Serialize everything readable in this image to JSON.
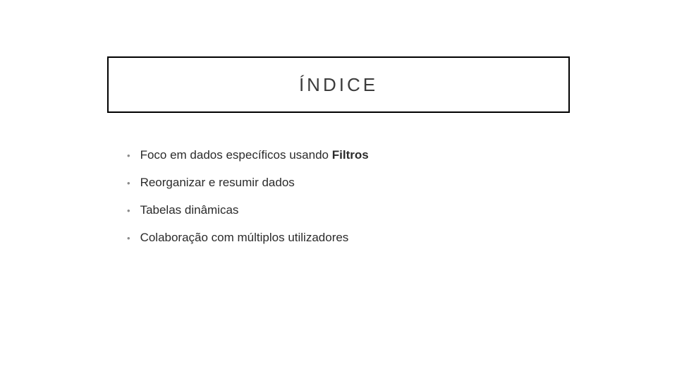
{
  "title": "ÍNDICE",
  "bullets": [
    {
      "text": "Foco em dados específicos usando ",
      "bold": "Filtros"
    },
    {
      "text": "Reorganizar e resumir dados",
      "bold": ""
    },
    {
      "text": "Tabelas dinâmicas",
      "bold": ""
    },
    {
      "text": "Colaboração com múltiplos utilizadores",
      "bold": ""
    }
  ]
}
